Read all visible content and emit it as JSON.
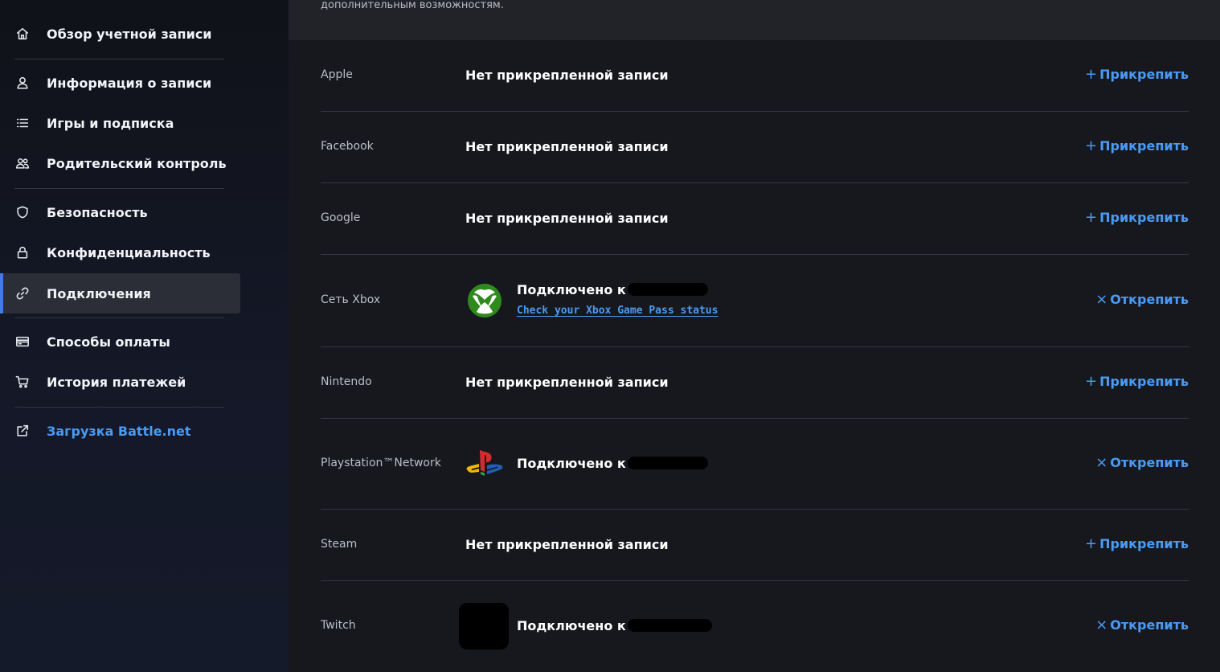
{
  "sidebar": {
    "items": [
      {
        "label": "Обзор учетной записи",
        "icon": "home-icon"
      },
      {
        "label": "Информация о записи",
        "icon": "user-icon"
      },
      {
        "label": "Игры и подписка",
        "icon": "list-icon"
      },
      {
        "label": "Родительский контроль",
        "icon": "users-icon"
      },
      {
        "label": "Безопасность",
        "icon": "shield-icon"
      },
      {
        "label": "Конфиденциальность",
        "icon": "lock-icon"
      },
      {
        "label": "Подключения",
        "icon": "link-icon",
        "active": true
      },
      {
        "label": "Способы оплаты",
        "icon": "credit-card-icon"
      },
      {
        "label": "История платежей",
        "icon": "cart-icon"
      },
      {
        "label": "Загрузка Battle.net",
        "icon": "external-link-icon"
      }
    ]
  },
  "main": {
    "banner_text": "дополнительным возможностям.",
    "connections": [
      {
        "platform": "Apple",
        "status": "Нет прикрепленной записи",
        "action": "Прикрепить",
        "action_icon": "plus-icon"
      },
      {
        "platform": "Facebook",
        "status": "Нет прикрепленной записи",
        "action": "Прикрепить",
        "action_icon": "plus-icon"
      },
      {
        "platform": "Google",
        "status": "Нет прикрепленной записи",
        "action": "Прикрепить",
        "action_icon": "plus-icon"
      },
      {
        "platform": "Сеть Xbox",
        "status": "Подключено к",
        "link": "Check your Xbox Game Pass status",
        "action": "Открепить",
        "action_icon": "close-icon",
        "logo": "xbox-logo"
      },
      {
        "platform": "Nintendo",
        "status": "Нет прикрепленной записи",
        "action": "Прикрепить",
        "action_icon": "plus-icon"
      },
      {
        "platform": "Playstation™Network",
        "status": "Подключено к",
        "action": "Открепить",
        "action_icon": "close-icon",
        "logo": "playstation-logo"
      },
      {
        "platform": "Steam",
        "status": "Нет прикрепленной записи",
        "action": "Прикрепить",
        "action_icon": "plus-icon"
      },
      {
        "platform": "Twitch",
        "status": "Подключено к",
        "action": "Открепить",
        "action_icon": "close-icon",
        "logo": "redacted-avatar"
      }
    ]
  },
  "colors": {
    "accent": "#4a9bf5",
    "active_bar": "#3f7de0",
    "background": "#17181e",
    "sidebar": "#141827"
  }
}
